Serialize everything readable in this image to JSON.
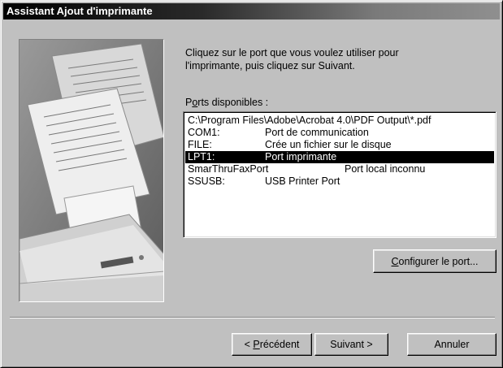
{
  "window": {
    "title": "Assistant Ajout d'imprimante"
  },
  "instructions": "Cliquez sur le port que vous voulez utiliser pour\nl'imprimante, puis cliquez sur Suivant.",
  "ports_label": {
    "before": "P",
    "mnemonic": "o",
    "after": "rts disponibles :"
  },
  "ports": [
    {
      "port": "C:\\Program Files\\Adobe\\Acrobat 4.0\\PDF Output\\*.pdf",
      "description": "",
      "selected": false
    },
    {
      "port": "COM1:",
      "description": "Port de communication",
      "selected": false
    },
    {
      "port": "FILE:",
      "description": "Crée un fichier sur le disque",
      "selected": false
    },
    {
      "port": "LPT1:",
      "description": "Port imprimante",
      "selected": true
    },
    {
      "port": "SmarThruFaxPort",
      "description": "Port local inconnu",
      "selected": false
    },
    {
      "port": "SSUSB:",
      "description": "USB Printer Port",
      "selected": false
    }
  ],
  "buttons": {
    "configure": {
      "mnemonic": "C",
      "rest": "onfigurer le port..."
    },
    "previous": {
      "prefix": "< ",
      "mnemonic": "P",
      "rest": "récédent"
    },
    "next": {
      "label": "Suivant >"
    },
    "cancel": {
      "label": "Annuler"
    }
  },
  "illustration": {
    "icon": "printer-with-documents-icon"
  }
}
